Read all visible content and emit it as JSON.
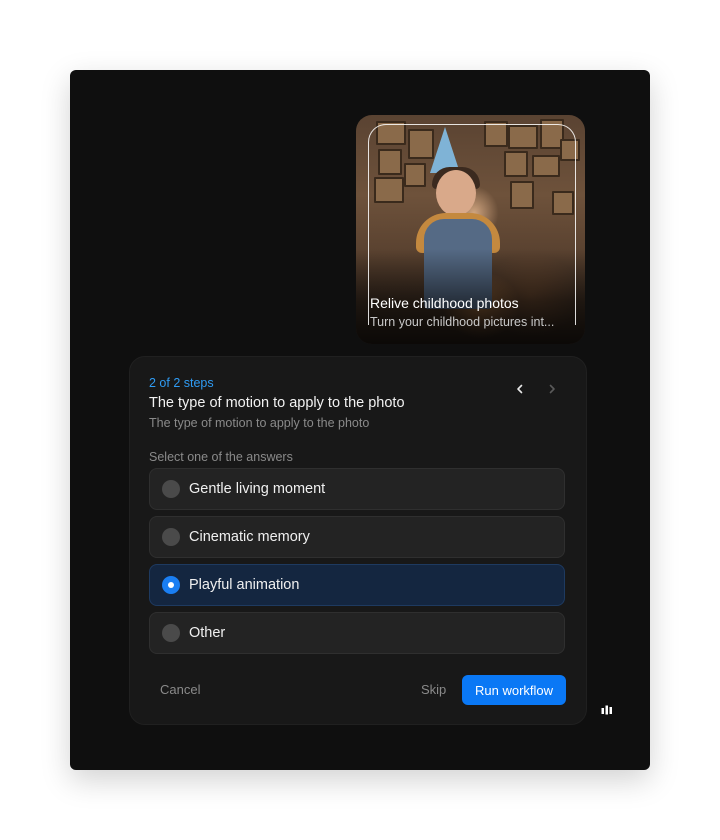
{
  "photo_card": {
    "title": "Relive childhood photos",
    "subtitle": "Turn your childhood pictures int..."
  },
  "question": {
    "step": "2 of 2 steps",
    "title": "The type of motion to apply to the photo",
    "description": "The type of motion to apply to the photo",
    "prompt": "Select one of the answers",
    "nav_prev_icon": "chevron-left-icon",
    "nav_next_icon": "chevron-right-icon",
    "options": [
      {
        "label": "Gentle living moment",
        "selected": false
      },
      {
        "label": "Cinematic memory",
        "selected": false
      },
      {
        "label": "Playful animation",
        "selected": true
      },
      {
        "label": "Other",
        "selected": false
      }
    ]
  },
  "footer": {
    "cancel_label": "Cancel",
    "skip_label": "Skip",
    "run_label": "Run workflow"
  },
  "colors": {
    "accent": "#0a78f5",
    "step_text": "#2f9bf3",
    "selected_bg": "#142640"
  }
}
